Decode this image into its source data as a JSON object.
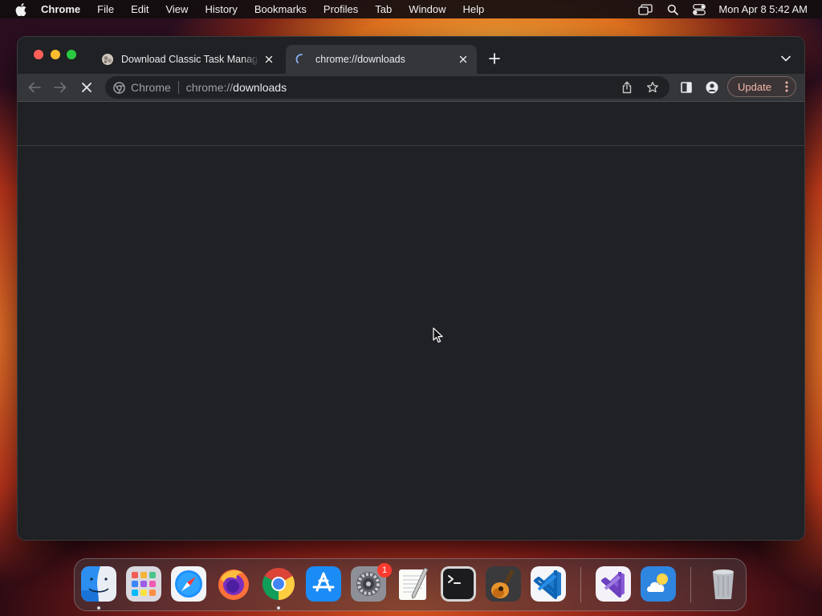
{
  "menubar": {
    "app_name": "Chrome",
    "items": [
      "File",
      "Edit",
      "View",
      "History",
      "Bookmarks",
      "Profiles",
      "Tab",
      "Window",
      "Help"
    ],
    "clock": "Mon Apr 8  5:42 AM",
    "status_icons": [
      "screen-mirroring-icon",
      "spotlight-search-icon",
      "control-center-icon"
    ]
  },
  "browser": {
    "tabs": [
      {
        "title": "Download Classic Task Manager",
        "favicon": "site-favicon",
        "active": false
      },
      {
        "title": "chrome://downloads",
        "favicon": "loading-spinner-icon",
        "active": true
      }
    ],
    "omnibox": {
      "chip_label": "Chrome",
      "url_scheme": "chrome://",
      "url_host": "downloads"
    },
    "update_label": "Update",
    "loading": true
  },
  "dock": {
    "apps": [
      "Finder",
      "Launchpad",
      "Safari",
      "Firefox",
      "Google Chrome",
      "App Store",
      "System Settings",
      "TextEdit",
      "Terminal",
      "GarageBand",
      "Visual Studio Code",
      "Visual Studio",
      "Weather",
      "Trash"
    ],
    "system_settings_badge": "1"
  },
  "colors": {
    "window_bg": "#202124",
    "toolbar_bg": "#35363a",
    "update_text": "#f2b8a8"
  }
}
